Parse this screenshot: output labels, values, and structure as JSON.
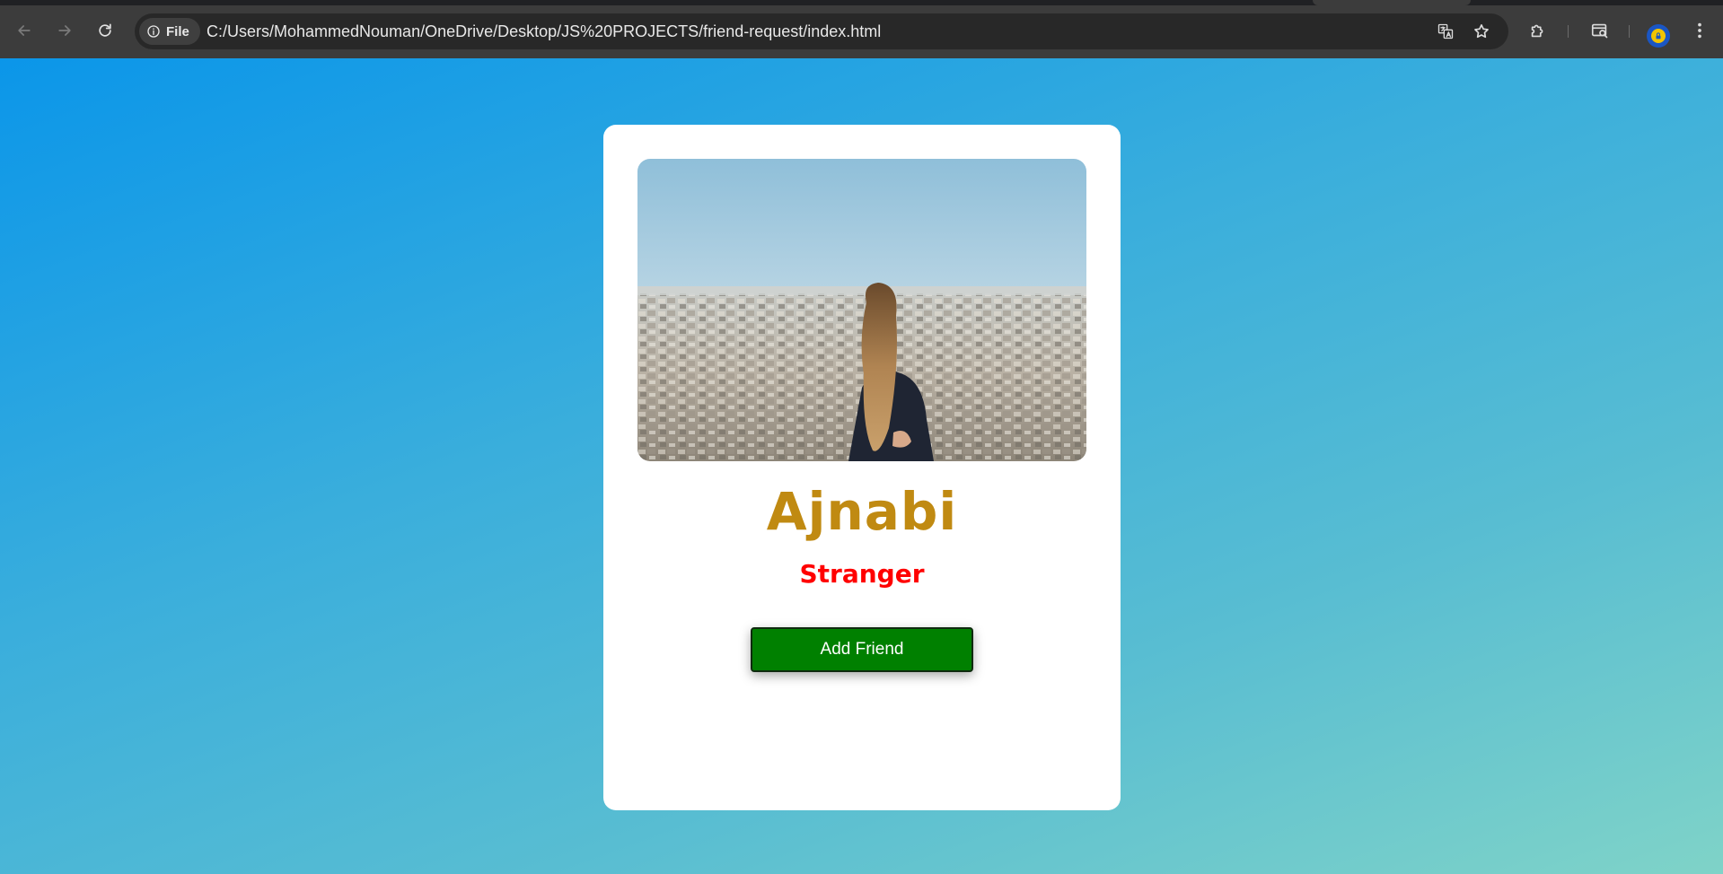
{
  "browser": {
    "site_chip_label": "File",
    "url": "C:/Users/MohammedNouman/OneDrive/Desktop/JS%20PROJECTS/friend-request/index.html",
    "icons": {
      "back": "back-arrow-icon",
      "forward": "forward-arrow-icon",
      "reload": "reload-icon",
      "site_info": "info-icon",
      "translate": "translate-icon",
      "bookmark": "star-icon",
      "extensions": "puzzle-icon",
      "search_tabs": "tab-search-icon",
      "profile": "profile-avatar-icon",
      "menu": "kebab-menu-icon"
    }
  },
  "card": {
    "image_icon": "city-view-photo",
    "name": "Ajnabi",
    "status": "Stranger",
    "button_label": "Add Friend"
  },
  "colors": {
    "name": "#c08a12",
    "status": "#ff0000",
    "button": "#008000",
    "gradient_start": "#0b96e9",
    "gradient_end": "#7fd3c8"
  }
}
